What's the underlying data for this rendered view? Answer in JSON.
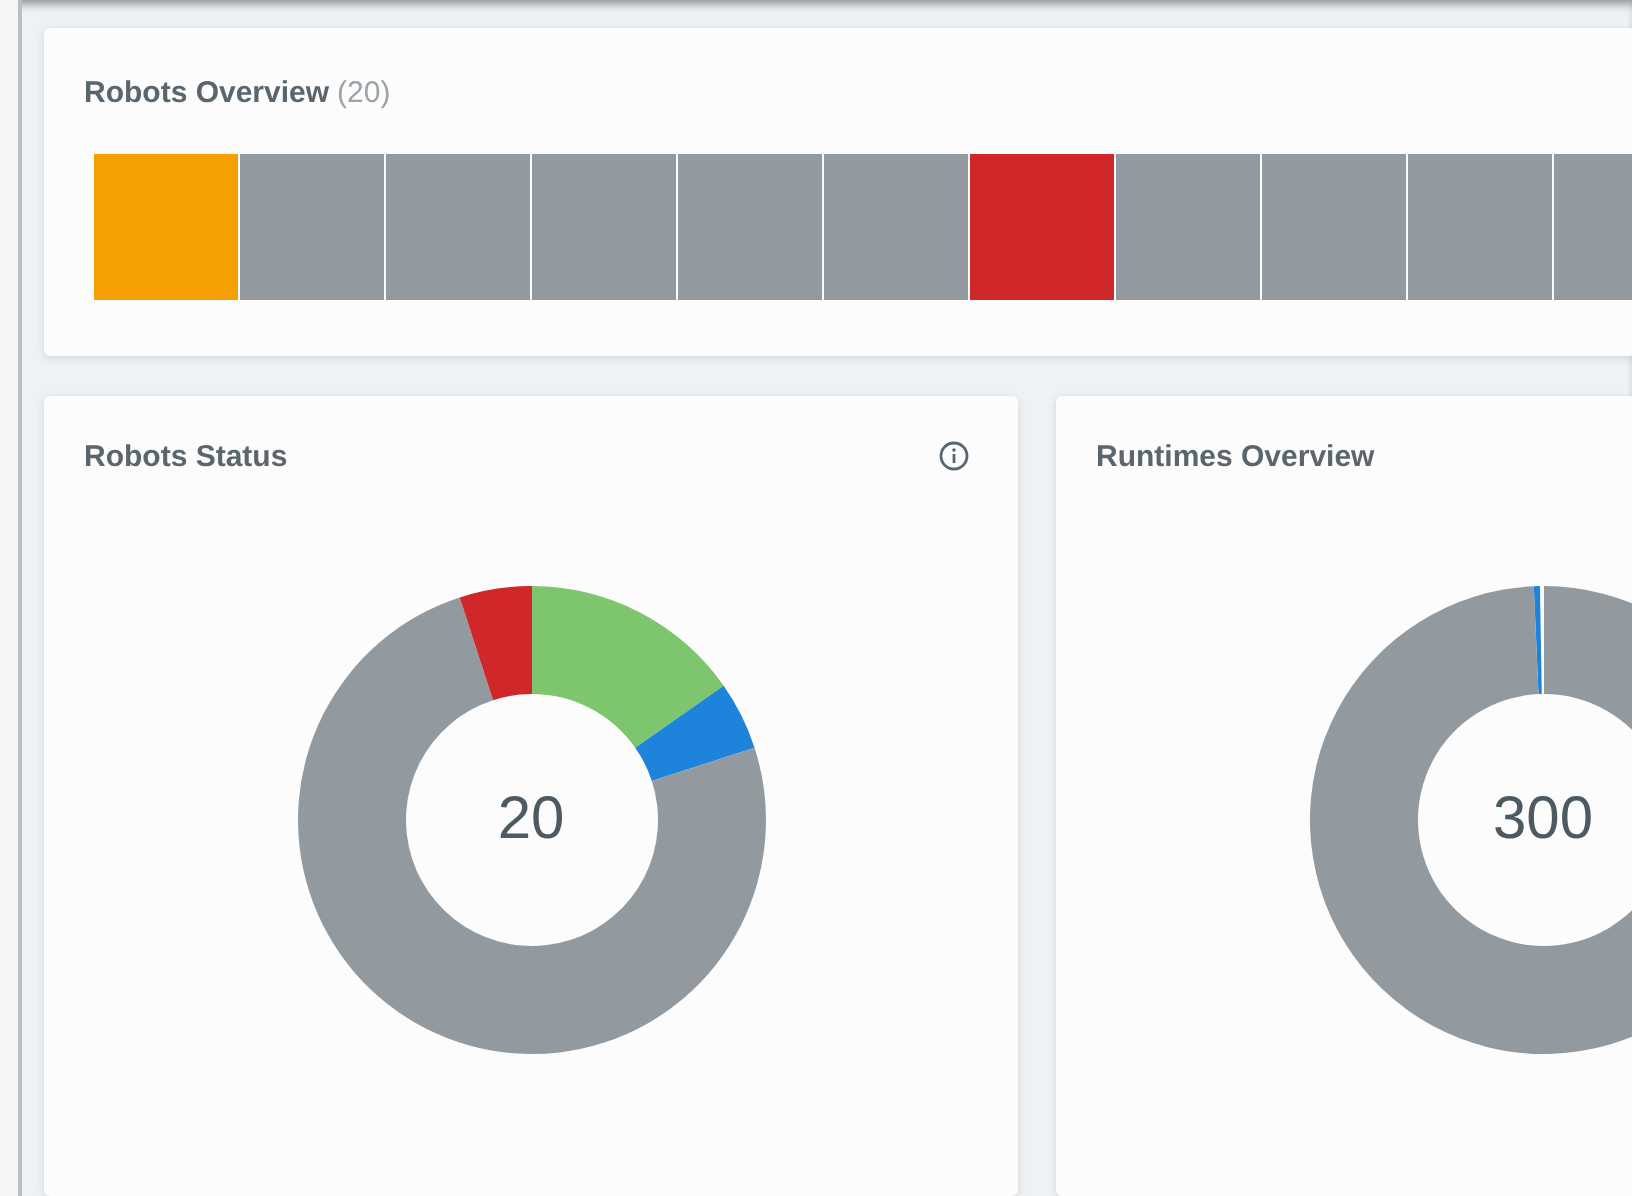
{
  "robots_overview": {
    "title": "Robots Overview",
    "count": "(20)",
    "robots": [
      {
        "color": "#f5a000"
      },
      {
        "color": "#929a9f"
      },
      {
        "color": "#929a9f"
      },
      {
        "color": "#929a9f"
      },
      {
        "color": "#929a9f"
      },
      {
        "color": "#929a9f"
      },
      {
        "color": "#d0272a"
      },
      {
        "color": "#929a9f"
      },
      {
        "color": "#929a9f"
      },
      {
        "color": "#929a9f"
      },
      {
        "color": "#929a9f"
      }
    ]
  },
  "robots_status": {
    "title": "Robots Status",
    "total": "20"
  },
  "runtimes_overview": {
    "title": "Runtimes Overview",
    "total": "300"
  }
}
